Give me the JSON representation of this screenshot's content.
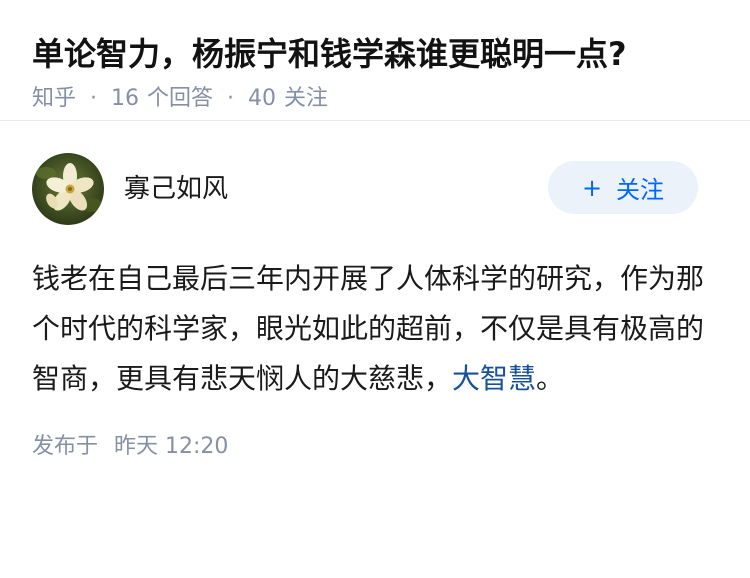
{
  "question": {
    "title": "单论智力，杨振宁和钱学森谁更聪明一点?",
    "source": "知乎",
    "separator": "·",
    "answers_count": "16",
    "answers_label": "个回答",
    "follows_count": "40",
    "follows_label": "关注"
  },
  "answer": {
    "author_name": "寡己如风",
    "follow_button_plus": "+",
    "follow_button_label": "关注",
    "content_text": "钱老在自己最后三年内开展了人体科学的研究，作为那个时代的科学家，眼光如此的超前，不仅是具有极高的智商，更具有悲天悯人的大慈悲，",
    "content_link": "大智慧",
    "content_end": "。",
    "published_label": "发布于",
    "published_time": "昨天 12:20"
  },
  "colors": {
    "link": "#175199",
    "accent": "#0066ff",
    "muted": "#8590a6",
    "follow_bg": "#ebf2fa"
  }
}
